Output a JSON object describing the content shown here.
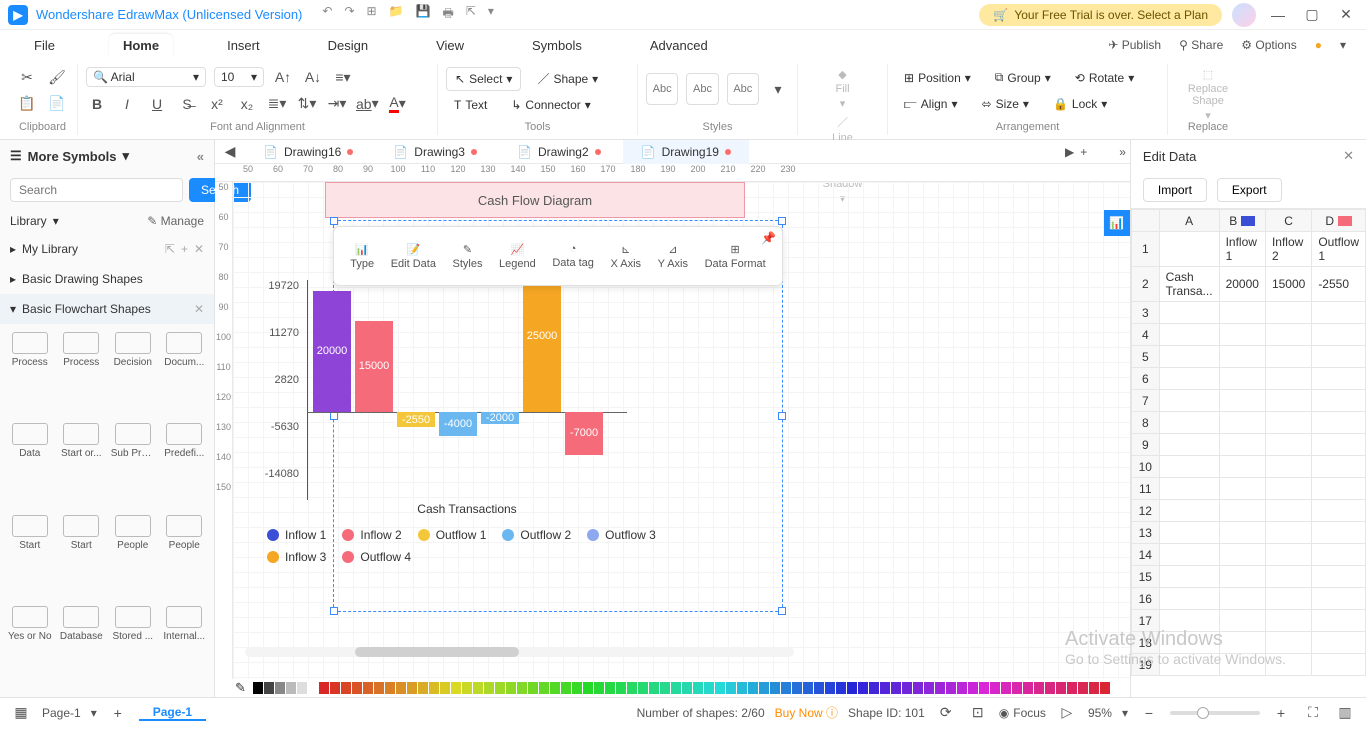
{
  "title": "Wondershare EdrawMax (Unlicensed Version)",
  "trial": "Your Free Trial is over. Select a Plan",
  "menuTabs": [
    "File",
    "Home",
    "Insert",
    "Design",
    "View",
    "Symbols",
    "Advanced"
  ],
  "menuRight": {
    "publish": "Publish",
    "share": "Share",
    "options": "Options"
  },
  "ribbon": {
    "clipboard": "Clipboard",
    "font": {
      "name": "Arial",
      "size": "10",
      "group": "Font and Alignment"
    },
    "tools": {
      "select": "Select",
      "shape": "Shape",
      "text": "Text",
      "connector": "Connector",
      "group": "Tools"
    },
    "abc": "Abc",
    "styles": "Styles",
    "fill": "Fill",
    "line": "Line",
    "shadow": "Shadow",
    "arr": {
      "position": "Position",
      "group": "Group",
      "rotate": "Rotate",
      "align": "Align",
      "size": "Size",
      "lock": "Lock",
      "label": "Arrangement"
    },
    "replace": {
      "btn": "Replace\nShape",
      "label": "Replace"
    }
  },
  "sidebar": {
    "title": "More Symbols",
    "searchPh": "Search",
    "searchBtn": "Search",
    "library": "Library",
    "manage": "Manage",
    "mylib": "My Library",
    "cats": [
      "Basic Drawing Shapes",
      "Basic Flowchart Shapes"
    ],
    "shapes": [
      "Process",
      "Process",
      "Decision",
      "Docum...",
      "Data",
      "Start or...",
      "Sub Pro...",
      "Predefi...",
      "Start",
      "Start",
      "People",
      "People",
      "Yes or No",
      "Database",
      "Stored ...",
      "Internal..."
    ]
  },
  "docTabs": [
    "Drawing16",
    "Drawing3",
    "Drawing2",
    "Drawing19"
  ],
  "rulerH": [
    50,
    60,
    70,
    80,
    90,
    100,
    110,
    120,
    130,
    140,
    150,
    160,
    170,
    180,
    190,
    200,
    210,
    220,
    230
  ],
  "rulerV": [
    50,
    60,
    70,
    80,
    90,
    100,
    110,
    120,
    130,
    140,
    150
  ],
  "pinkTitle": "Cash Flow Diagram",
  "floatTb": [
    "Type",
    "Edit Data",
    "Styles",
    "Legend",
    "Data tag",
    "X Axis",
    "Y Axis",
    "Data Format"
  ],
  "chart_data": {
    "type": "bar",
    "title": "Cash Flow Diagram",
    "xlabel": "Cash Transactions",
    "yticks": [
      19720,
      11270,
      2820,
      -5630,
      -14080
    ],
    "series": [
      {
        "name": "Inflow 1",
        "value": 20000,
        "color": "#8e44d6"
      },
      {
        "name": "Inflow 2",
        "value": 15000,
        "color": "#f56b7a"
      },
      {
        "name": "Outflow 1",
        "value": -2550,
        "color": "#f4c73a"
      },
      {
        "name": "Outflow 2",
        "value": -4000,
        "color": "#6bb7f0"
      },
      {
        "name": "Outflow 3",
        "value": -2000,
        "color": "#6bb7f0"
      },
      {
        "name": "Inflow 3",
        "value": 25000,
        "color": "#f5a623"
      },
      {
        "name": "Outflow 4",
        "value": -7000,
        "color": "#f56b7a"
      }
    ],
    "legend": [
      {
        "name": "Inflow 1",
        "color": "#3a4fd6"
      },
      {
        "name": "Inflow 2",
        "color": "#f56b7a"
      },
      {
        "name": "Outflow 1",
        "color": "#f4c73a"
      },
      {
        "name": "Outflow 2",
        "color": "#6bb7f0"
      },
      {
        "name": "Outflow 3",
        "color": "#8ea8f0"
      },
      {
        "name": "Inflow 3",
        "color": "#f5a623"
      },
      {
        "name": "Outflow 4",
        "color": "#f56b7a"
      }
    ]
  },
  "editData": {
    "title": "Edit Data",
    "import": "Import",
    "export": "Export",
    "cols": [
      "A",
      "B",
      "C",
      "D"
    ],
    "colColors": [
      "",
      "#3a4fd6",
      "",
      "#f56b7a"
    ],
    "headers": [
      "",
      "Inflow 1",
      "Inflow 2",
      "Outflow 1"
    ],
    "row": [
      "Cash Transa...",
      "20000",
      "15000",
      "-2550"
    ]
  },
  "status": {
    "page": "Page-1",
    "pageTab": "Page-1",
    "shapes": "Number of shapes: 2/60",
    "buy": "Buy Now",
    "shapeId": "Shape ID: 101",
    "focus": "Focus",
    "zoom": "95%"
  },
  "wm": {
    "t1": "Activate Windows",
    "t2": "Go to Settings to activate Windows."
  }
}
